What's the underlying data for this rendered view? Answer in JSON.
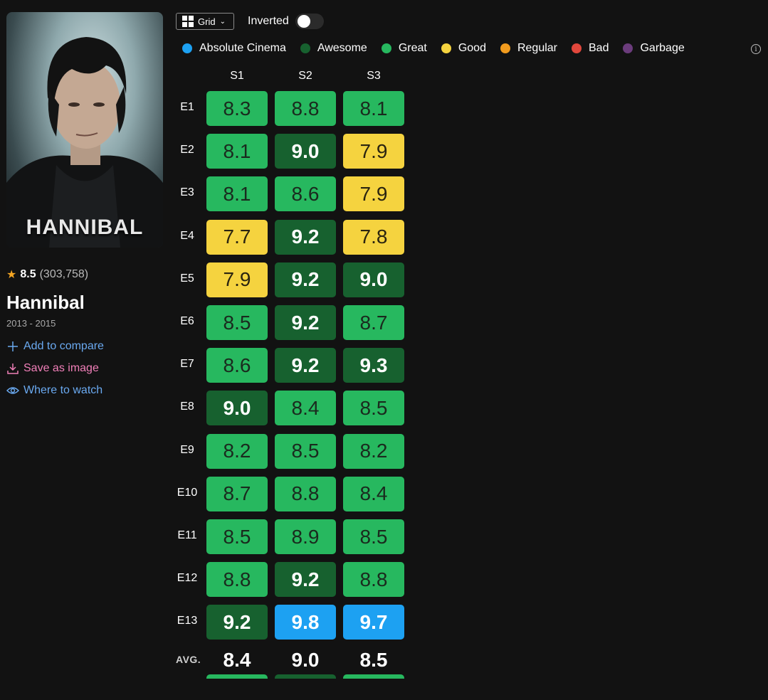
{
  "show": {
    "poster_text": "HANNIBAL",
    "rating": "8.5",
    "votes": "(303,758)",
    "title": "Hannibal",
    "years": "2013 - 2015"
  },
  "actions": {
    "compare": "Add to compare",
    "save": "Save as image",
    "watch": "Where to watch"
  },
  "toolbar": {
    "view_label": "Grid",
    "inverted_label": "Inverted",
    "inverted_on": false
  },
  "legend": [
    {
      "label": "Absolute Cinema",
      "color": "#1da1f2"
    },
    {
      "label": "Awesome",
      "color": "#17612f"
    },
    {
      "label": "Great",
      "color": "#27b85f"
    },
    {
      "label": "Good",
      "color": "#f5d33f"
    },
    {
      "label": "Regular",
      "color": "#f19b1e"
    },
    {
      "label": "Bad",
      "color": "#e1473c"
    },
    {
      "label": "Garbage",
      "color": "#6b3c7c"
    }
  ],
  "seasons": [
    "S1",
    "S2",
    "S3"
  ],
  "episodes": [
    "E1",
    "E2",
    "E3",
    "E4",
    "E5",
    "E6",
    "E7",
    "E8",
    "E9",
    "E10",
    "E11",
    "E12",
    "E13"
  ],
  "ratings": [
    [
      "8.3",
      "8.8",
      "8.1"
    ],
    [
      "8.1",
      "9.0",
      "7.9"
    ],
    [
      "8.1",
      "8.6",
      "7.9"
    ],
    [
      "7.7",
      "9.2",
      "7.8"
    ],
    [
      "7.9",
      "9.2",
      "9.0"
    ],
    [
      "8.5",
      "9.2",
      "8.7"
    ],
    [
      "8.6",
      "9.2",
      "9.3"
    ],
    [
      "9.0",
      "8.4",
      "8.5"
    ],
    [
      "8.2",
      "8.5",
      "8.2"
    ],
    [
      "8.7",
      "8.8",
      "8.4"
    ],
    [
      "8.5",
      "8.9",
      "8.5"
    ],
    [
      "8.8",
      "9.2",
      "8.8"
    ],
    [
      "9.2",
      "9.8",
      "9.7"
    ]
  ],
  "averages": {
    "label": "AVG.",
    "values": [
      "8.4",
      "9.0",
      "8.5"
    ]
  }
}
